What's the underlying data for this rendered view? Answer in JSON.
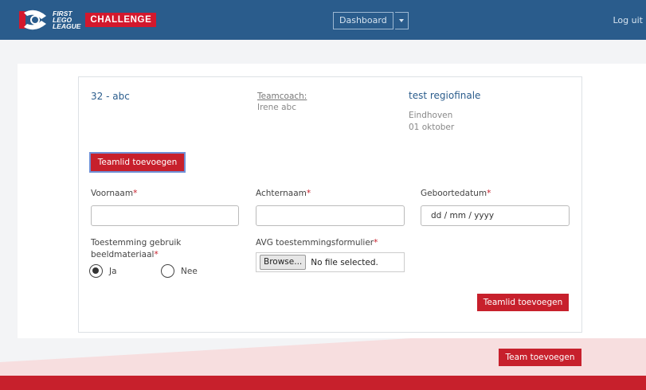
{
  "header": {
    "logo_lines": [
      "FIRST",
      "LEGO",
      "LEAGUE"
    ],
    "logo_badge": "CHALLENGE",
    "dashboard_label": "Dashboard",
    "logout_label": "Log uit"
  },
  "team": {
    "name": "32 - abc",
    "coach_label": "Teamcoach:",
    "coach_name": "Irene abc"
  },
  "event": {
    "title": "test regiofinale",
    "city": "Eindhoven",
    "date": "01 oktober"
  },
  "form": {
    "toggle_button": "Teamlid toevoegen",
    "first_name_label": "Voornaam",
    "last_name_label": "Achternaam",
    "birthdate_label": "Geboortedatum",
    "birthdate_placeholder": "dd / mm / yyyy",
    "required_mark": "*",
    "consent_label_line1": "Toestemming gebruik",
    "consent_label_line2": "beeldmateriaal",
    "radio_yes": "Ja",
    "radio_no": "Nee",
    "avg_label": "AVG toestemmingsformulier",
    "browse_label": "Browse...",
    "no_file": "No file selected.",
    "submit_button": "Teamlid toevoegen"
  },
  "footer": {
    "add_team_button": "Team toevoegen"
  },
  "colors": {
    "header_blue": "#2a5c8c",
    "brand_red": "#c7202c",
    "link_blue": "#2a5c8c"
  }
}
